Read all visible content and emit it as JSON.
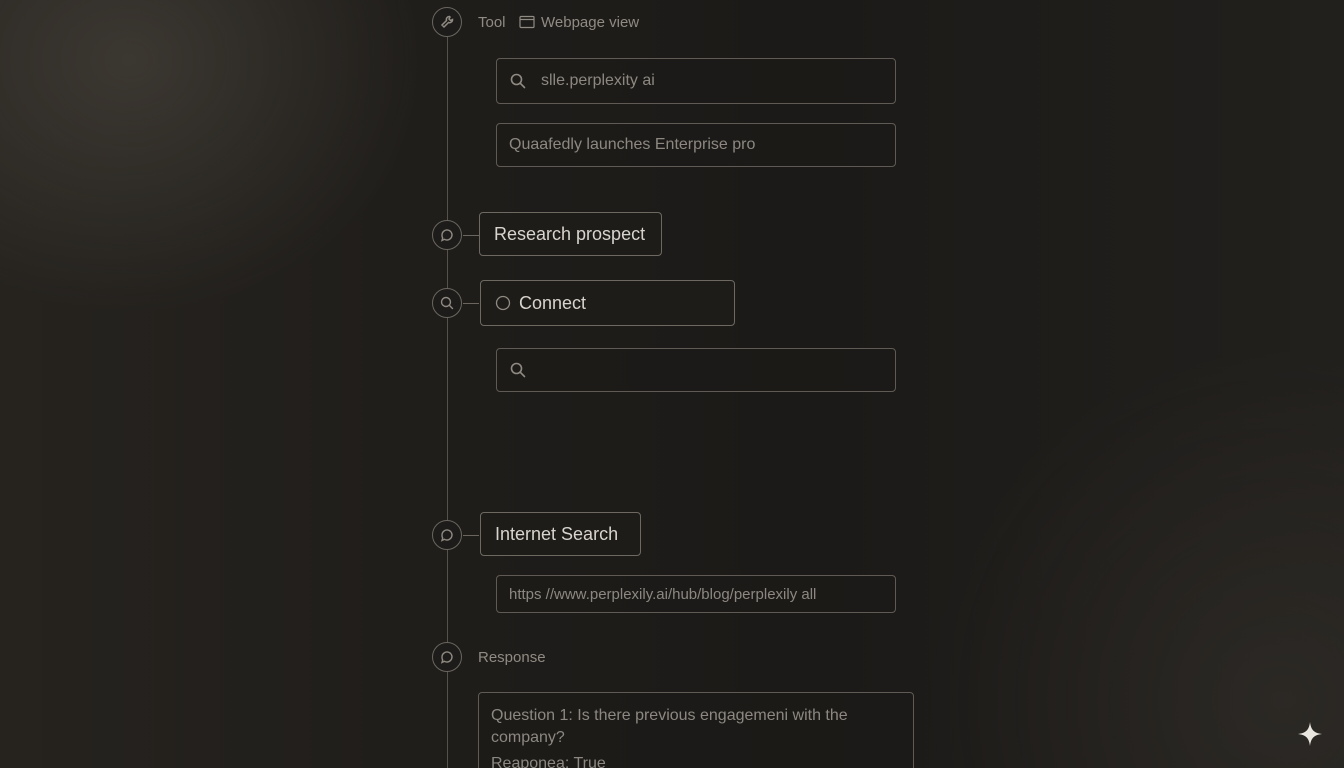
{
  "tool_step": {
    "label": "Tool",
    "view_label": "Webpage view",
    "search_field_value": "slle.perplexity ai",
    "result_field_value": "Quaafedly launches Enterprise pro"
  },
  "research_step": {
    "label": "Research prospect"
  },
  "connect_step": {
    "label": "Connect",
    "search_field_value": ""
  },
  "internet_step": {
    "label": "Internet Search",
    "url_value": "https //www.perplexily.ai/hub/blog/perplexily all"
  },
  "response_step": {
    "label": "Response",
    "question": "Question 1: Is there previous engagemeni with the company?",
    "answer": "Reaponea:  True"
  },
  "icons": {
    "tool": "wrench-icon",
    "view": "browser-window-icon",
    "search": "search-icon",
    "chat": "chat-bubble-icon",
    "sparkle": "sparkle-icon",
    "radio": "radio-circle-icon"
  }
}
